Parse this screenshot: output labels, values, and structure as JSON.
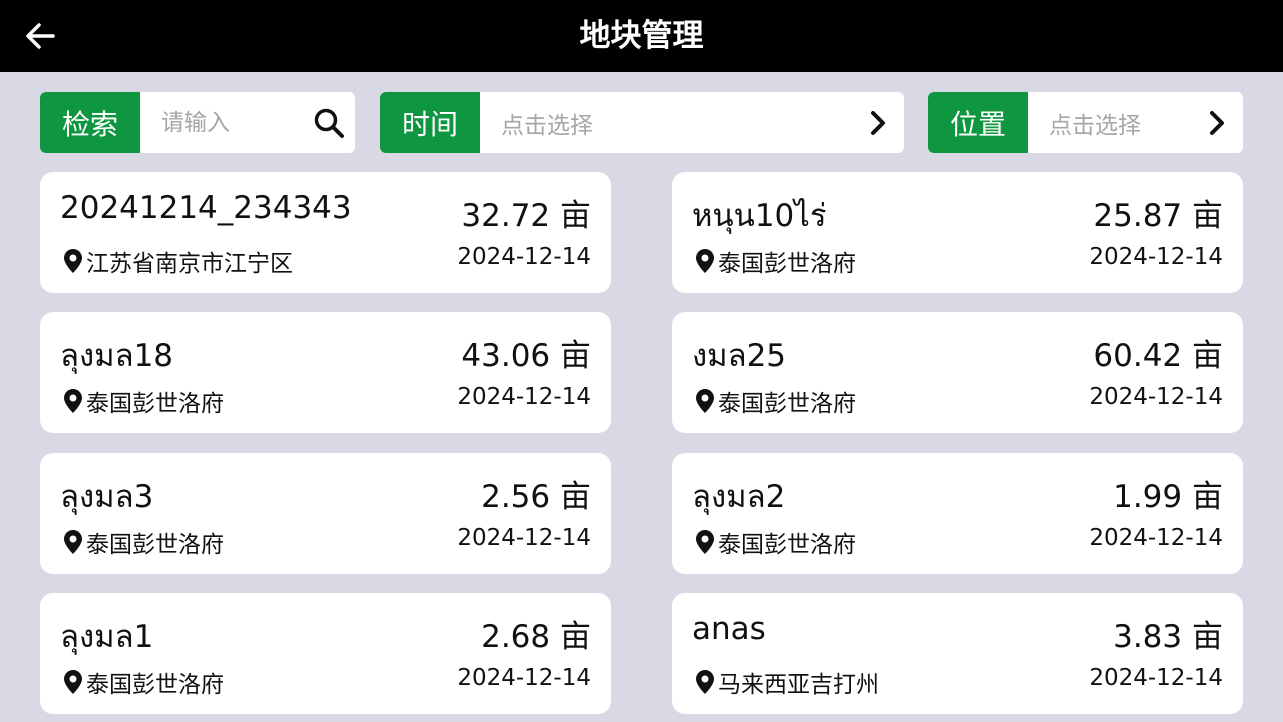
{
  "header": {
    "title": "地块管理",
    "back_icon": "arrow-left-icon"
  },
  "filters": {
    "search": {
      "label": "检索",
      "placeholder": "请输入",
      "icon": "search-icon"
    },
    "time": {
      "label": "时间",
      "placeholder": "点击选择",
      "icon": "chevron-right-icon"
    },
    "location": {
      "label": "位置",
      "placeholder": "点击选择",
      "icon": "chevron-right-icon"
    }
  },
  "colors": {
    "accent": "#0f9640",
    "background": "#d9d9e5",
    "header": "#000000"
  },
  "plots": [
    {
      "name": "20241214_234343",
      "area": "32.72 亩",
      "location": "江苏省南京市江宁区",
      "date": "2024-12-14"
    },
    {
      "name": "หนุน10ไร่",
      "area": "25.87 亩",
      "location": "泰国彭世洛府",
      "date": "2024-12-14"
    },
    {
      "name": "ลุงมล18",
      "area": "43.06 亩",
      "location": "泰国彭世洛府",
      "date": "2024-12-14"
    },
    {
      "name": "งมล25",
      "area": "60.42 亩",
      "location": "泰国彭世洛府",
      "date": "2024-12-14"
    },
    {
      "name": "ลุงมล3",
      "area": "2.56 亩",
      "location": "泰国彭世洛府",
      "date": "2024-12-14"
    },
    {
      "name": "ลุงมล2",
      "area": "1.99 亩",
      "location": "泰国彭世洛府",
      "date": "2024-12-14"
    },
    {
      "name": "ลุงมล1",
      "area": "2.68 亩",
      "location": "泰国彭世洛府",
      "date": "2024-12-14"
    },
    {
      "name": "anas",
      "area": "3.83 亩",
      "location": "马来西亚吉打州",
      "date": "2024-12-14"
    }
  ]
}
